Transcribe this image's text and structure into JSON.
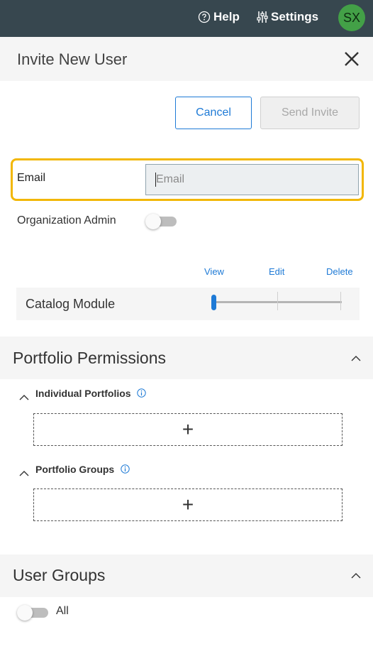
{
  "topbar": {
    "help_label": "Help",
    "settings_label": "Settings",
    "avatar_initials": "SX",
    "avatar_color": "#43a047",
    "bar_color": "#37474f"
  },
  "panel": {
    "title": "Invite New User",
    "cancel_label": "Cancel",
    "send_label": "Send Invite"
  },
  "form": {
    "email_label": "Email",
    "email_placeholder": "Email",
    "email_value": "",
    "org_admin_label": "Organization Admin",
    "org_admin_enabled": false
  },
  "catalog": {
    "levels": [
      "View",
      "Edit",
      "Delete"
    ],
    "module_label": "Catalog Module",
    "selected_level": "View"
  },
  "portfolio_permissions": {
    "title": "Portfolio Permissions",
    "individual_label": "Individual Portfolios",
    "groups_label": "Portfolio Groups",
    "add_symbol": "+"
  },
  "user_groups": {
    "title": "User Groups",
    "all_label": "All",
    "all_enabled": false
  },
  "colors": {
    "accent": "#1e7ad6",
    "highlight": "#f2b705"
  }
}
